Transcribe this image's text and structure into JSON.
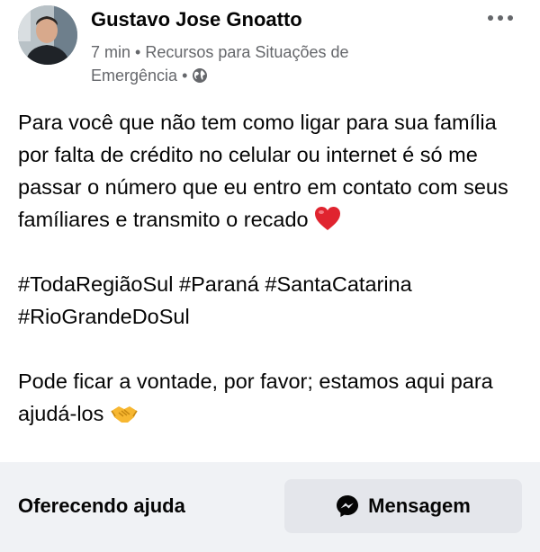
{
  "post": {
    "author": "Gustavo Jose Gnoatto",
    "time": "7 min",
    "separator": "•",
    "group": "Recursos para Situações de Emergência",
    "audience_icon": "globe-icon",
    "body_paragraph_1": "Para você que não tem como ligar para sua família por falta de crédito no celular ou internet é só me passar o número que eu entro em contato com seus famíliares e transmito o recado",
    "hashtags": [
      "#TodaRegiãoSul",
      "#Paraná",
      "#SantaCatarina",
      "#RioGrandeDoSul"
    ],
    "body_paragraph_3": "Pode ficar a vontade, por favor; estamos aqui para ajudá-los"
  },
  "footer": {
    "offer_label": "Oferecendo ajuda",
    "message_button_label": "Mensagem",
    "message_icon": "messenger-icon"
  },
  "colors": {
    "text": "#050505",
    "secondary_text": "#65676b",
    "footer_bg": "#f0f2f5",
    "button_bg": "#e4e6eb",
    "heart": "#e0242f",
    "handshake": "#f7b731"
  }
}
